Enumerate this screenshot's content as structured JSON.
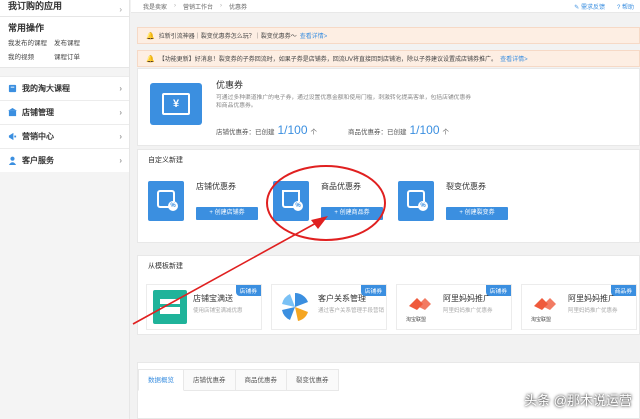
{
  "sidebar": {
    "my_apps": "我订购的应用",
    "common": {
      "title": "常用操作",
      "links": [
        "我发布的课程",
        "发布课程",
        "我的视频",
        "课程订单"
      ]
    },
    "items": [
      {
        "label": "我的淘大课程",
        "icon": "book-icon"
      },
      {
        "label": "店铺管理",
        "icon": "store-icon"
      },
      {
        "label": "营销中心",
        "icon": "marketing-icon"
      },
      {
        "label": "客户服务",
        "icon": "customer-icon"
      }
    ]
  },
  "topbar": {
    "breadcrumb": [
      "我是卖家",
      "营销工作台",
      "优惠券"
    ],
    "actions": [
      "需求反馈",
      "帮助"
    ]
  },
  "notices": [
    {
      "text": "拉新引流神器｜裂变优惠券怎么玩？｜裂变优惠券～",
      "link": "查看详情>"
    },
    {
      "text": "【功能更新】好消息！裂变券的子券回流时，如果子券是店铺券，回流UV将直接回到店铺池，除以子券建议设置成店铺券推广。",
      "link": "查看详情>"
    }
  ],
  "hero": {
    "title": "优惠券",
    "description": "可通过多种渠道推广的电子券，通过设置优惠金额和使用门槛，刺激转化提高客单，包括店铺优惠券和商品优惠券。",
    "shop_quota_label": "店铺优惠券：已创建",
    "shop_quota_value": "1/100",
    "shop_quota_unit": "个",
    "item_quota_label": "商品优惠券：已创建",
    "item_quota_value": "1/100",
    "item_quota_unit": "个"
  },
  "custom": {
    "title": "自定义新建",
    "cards": [
      {
        "name": "店铺优惠券",
        "button": "+ 创建店铺券"
      },
      {
        "name": "商品优惠券",
        "button": "+ 创建商品券"
      },
      {
        "name": "裂变优惠券",
        "button": "+ 创建裂变券"
      }
    ]
  },
  "templates": {
    "title": "从模板新建",
    "cards": [
      {
        "name": "店铺宝满送",
        "desc": "使用店铺宝满减优惠",
        "tag": "店铺券"
      },
      {
        "name": "客户关系管理",
        "desc": "通过客户关系管理手段营销",
        "tag": "店铺券"
      },
      {
        "name": "阿里妈妈推广",
        "desc": "阿里妈妈推广优惠券",
        "tag": "店铺券"
      },
      {
        "name": "阿里妈妈推广",
        "desc": "阿里妈妈推广优惠券",
        "tag": "商品券"
      }
    ],
    "taobao_union": "淘宝联盟"
  },
  "tabs": [
    "数据概览",
    "店铺优惠券",
    "商品优惠券",
    "裂变优惠券"
  ],
  "watermark": "头条 @那木说运营",
  "colors": {
    "accent": "#3b8fe0",
    "notice_bg": "#fdeee3",
    "annotation": "#e02020"
  }
}
